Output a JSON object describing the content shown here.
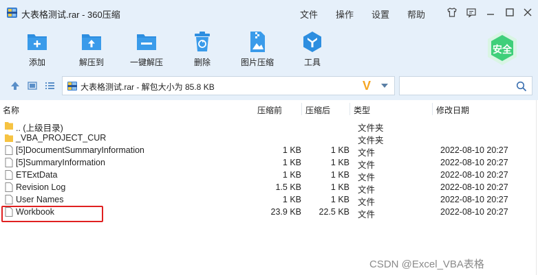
{
  "window": {
    "title": "大表格测试.rar - 360压缩",
    "menu": [
      "文件",
      "操作",
      "设置",
      "帮助"
    ]
  },
  "toolbar": {
    "items": [
      {
        "label": "添加",
        "icon": "add-icon"
      },
      {
        "label": "解压到",
        "icon": "extract-to-icon"
      },
      {
        "label": "一键解压",
        "icon": "one-click-extract-icon"
      },
      {
        "label": "删除",
        "icon": "delete-icon"
      },
      {
        "label": "图片压缩",
        "icon": "image-compress-icon"
      },
      {
        "label": "工具",
        "icon": "tools-icon"
      }
    ],
    "safe_badge": "安全"
  },
  "address": {
    "path": "大表格测试.rar - 解包大小为 85.8 KB",
    "search_placeholder": ""
  },
  "columns": {
    "name": "名称",
    "compressed": "压缩前",
    "original": "压缩后",
    "type": "类型",
    "modified": "修改日期"
  },
  "files": [
    {
      "name": ".. (上级目录)",
      "compressed": "",
      "original": "",
      "type": "文件夹",
      "modified": "",
      "kind": "folder"
    },
    {
      "name": "_VBA_PROJECT_CUR",
      "compressed": "",
      "original": "",
      "type": "文件夹",
      "modified": "",
      "kind": "folder"
    },
    {
      "name": "[5]DocumentSummaryInformation",
      "compressed": "1 KB",
      "original": "1 KB",
      "type": "文件",
      "modified": "2022-08-10 20:27",
      "kind": "file"
    },
    {
      "name": "[5]SummaryInformation",
      "compressed": "1 KB",
      "original": "1 KB",
      "type": "文件",
      "modified": "2022-08-10 20:27",
      "kind": "file"
    },
    {
      "name": "ETExtData",
      "compressed": "1 KB",
      "original": "1 KB",
      "type": "文件",
      "modified": "2022-08-10 20:27",
      "kind": "file"
    },
    {
      "name": "Revision Log",
      "compressed": "1.5 KB",
      "original": "1 KB",
      "type": "文件",
      "modified": "2022-08-10 20:27",
      "kind": "file"
    },
    {
      "name": "User Names",
      "compressed": "1 KB",
      "original": "1 KB",
      "type": "文件",
      "modified": "2022-08-10 20:27",
      "kind": "file"
    },
    {
      "name": "Workbook",
      "compressed": "23.9 KB",
      "original": "22.5 KB",
      "type": "文件",
      "modified": "2022-08-10 20:27",
      "kind": "file"
    }
  ],
  "watermark": "CSDN @Excel_VBA表格",
  "colors": {
    "accent": "#2d8ee0",
    "toolbar_bg": "#e6f0fa",
    "safe_green": "#3fcf7a",
    "folder": "#f6c342",
    "highlight": "#e02020"
  }
}
